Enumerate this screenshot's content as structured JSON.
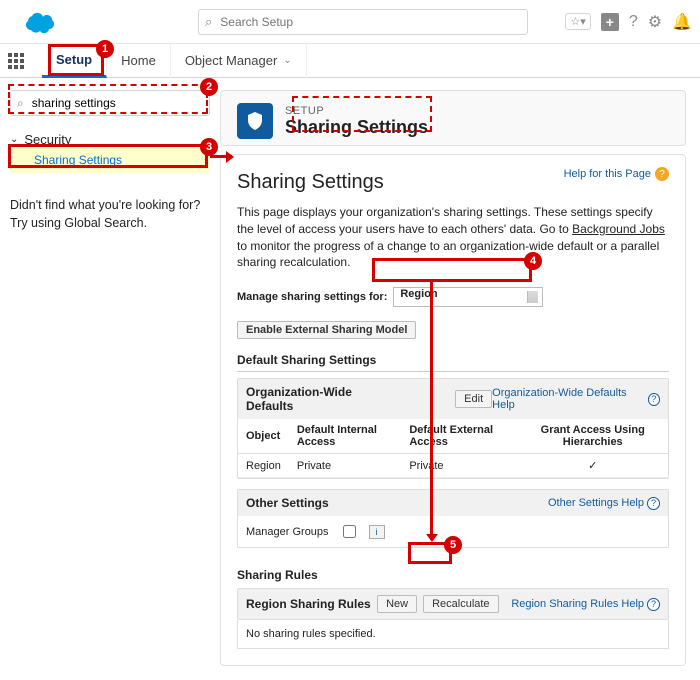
{
  "header": {
    "global_search_placeholder": "Search Setup"
  },
  "tabs": {
    "setup": "Setup",
    "home": "Home",
    "obj_mgr": "Object Manager"
  },
  "quick_find": {
    "value": "sharing settings"
  },
  "tree": {
    "section": "Security",
    "item": "Sharing Settings"
  },
  "hint": "Didn't find what you're looking for? Try using Global Search.",
  "crumb": {
    "s": "SETUP",
    "t": "Sharing Settings"
  },
  "page": {
    "title": "Sharing Settings",
    "help": "Help for this Page",
    "desc_a": "This page displays your organization's sharing settings. These settings specify the level of access your users have to each others' data. Go to ",
    "desc_link": "Background Jobs",
    "desc_b": " to monitor the progress of a change to an organization-wide default or a parallel sharing recalculation.",
    "mgr_label": "Manage sharing settings for:",
    "mgr_sel": "Region",
    "btn_ext": "Enable External Sharing Model",
    "sect_default": "Default Sharing Settings",
    "owd": {
      "title": "Organization-Wide Defaults",
      "edit": "Edit",
      "help": "Organization-Wide Defaults Help",
      "cols": {
        "obj": "Object",
        "dia": "Default Internal Access",
        "dea": "Default External Access",
        "grant": "Grant Access Using Hierarchies"
      },
      "row": {
        "obj": "Region",
        "dia": "Private",
        "dea": "Private",
        "grant": "✓"
      }
    },
    "other": {
      "title": "Other Settings",
      "help": "Other Settings Help",
      "mg": "Manager Groups"
    },
    "sect_rules": "Sharing Rules",
    "rules": {
      "title": "Region Sharing Rules",
      "new": "New",
      "recalc": "Recalculate",
      "help": "Region Sharing Rules Help",
      "empty": "No sharing rules specified."
    }
  },
  "badges": {
    "b1": "1",
    "b2": "2",
    "b3": "3",
    "b4": "4",
    "b5": "5"
  }
}
